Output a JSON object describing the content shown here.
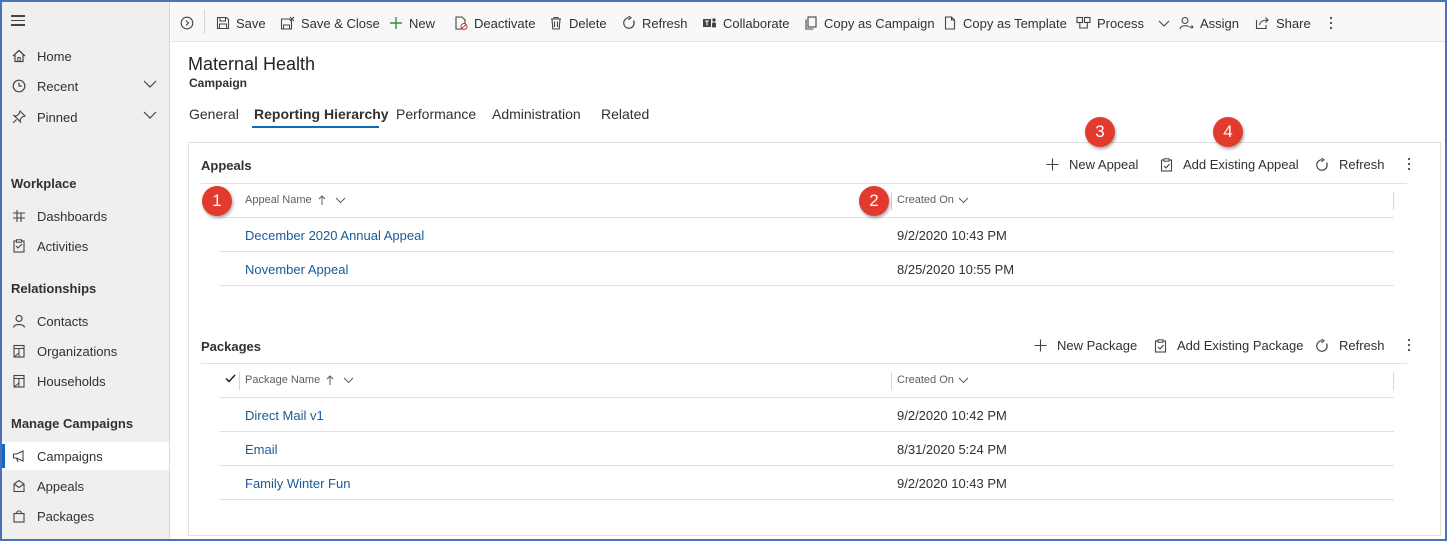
{
  "sidebar": {
    "items": [
      {
        "label": "Home",
        "icon": "home-icon"
      },
      {
        "label": "Recent",
        "icon": "clock-icon"
      },
      {
        "label": "Pinned",
        "icon": "pin-icon"
      }
    ],
    "sections": [
      {
        "label": "Workplace",
        "items": [
          {
            "label": "Dashboards",
            "icon": "dashboard-icon"
          },
          {
            "label": "Activities",
            "icon": "clipboard-icon"
          }
        ]
      },
      {
        "label": "Relationships",
        "items": [
          {
            "label": "Contacts",
            "icon": "person-icon"
          },
          {
            "label": "Organizations",
            "icon": "building-icon"
          },
          {
            "label": "Households",
            "icon": "building-icon"
          }
        ]
      },
      {
        "label": "Manage Campaigns",
        "items": [
          {
            "label": "Campaigns",
            "icon": "megaphone-icon",
            "active": true
          },
          {
            "label": "Appeals",
            "icon": "appeal-icon"
          },
          {
            "label": "Packages",
            "icon": "package-icon"
          }
        ]
      }
    ]
  },
  "toolbar": {
    "save": "Save",
    "save_close": "Save & Close",
    "new": "New",
    "deactivate": "Deactivate",
    "delete": "Delete",
    "refresh": "Refresh",
    "collaborate": "Collaborate",
    "copy_campaign": "Copy as Campaign",
    "copy_template": "Copy as Template",
    "process": "Process",
    "assign": "Assign",
    "share": "Share"
  },
  "record": {
    "title": "Maternal Health",
    "entity": "Campaign"
  },
  "tabs": [
    "General",
    "Reporting Hierarchy",
    "Performance",
    "Administration",
    "Related"
  ],
  "appeals": {
    "title": "Appeals",
    "new_label": "New Appeal",
    "add_existing_label": "Add Existing Appeal",
    "refresh_label": "Refresh",
    "col_name": "Appeal Name",
    "col_created": "Created On",
    "rows": [
      {
        "name": "December 2020 Annual Appeal",
        "created": "9/2/2020 10:43 PM"
      },
      {
        "name": "November Appeal",
        "created": "8/25/2020 10:55 PM"
      }
    ]
  },
  "packages": {
    "title": "Packages",
    "new_label": "New Package",
    "add_existing_label": "Add Existing Package",
    "refresh_label": "Refresh",
    "col_name": "Package Name",
    "col_created": "Created On",
    "rows": [
      {
        "name": "Direct Mail v1",
        "created": "9/2/2020 10:42 PM"
      },
      {
        "name": "Email",
        "created": "8/31/2020 5:24 PM"
      },
      {
        "name": "Family Winter Fun",
        "created": "9/2/2020 10:43 PM"
      }
    ]
  },
  "callouts": {
    "badge1": "1",
    "badge2": "2",
    "num3": "3",
    "num4": "4"
  },
  "colors": {
    "accent": "#0f6cbd",
    "link": "#1a5a99",
    "badge": "#e23b2e",
    "frame": "#4a72b8"
  }
}
